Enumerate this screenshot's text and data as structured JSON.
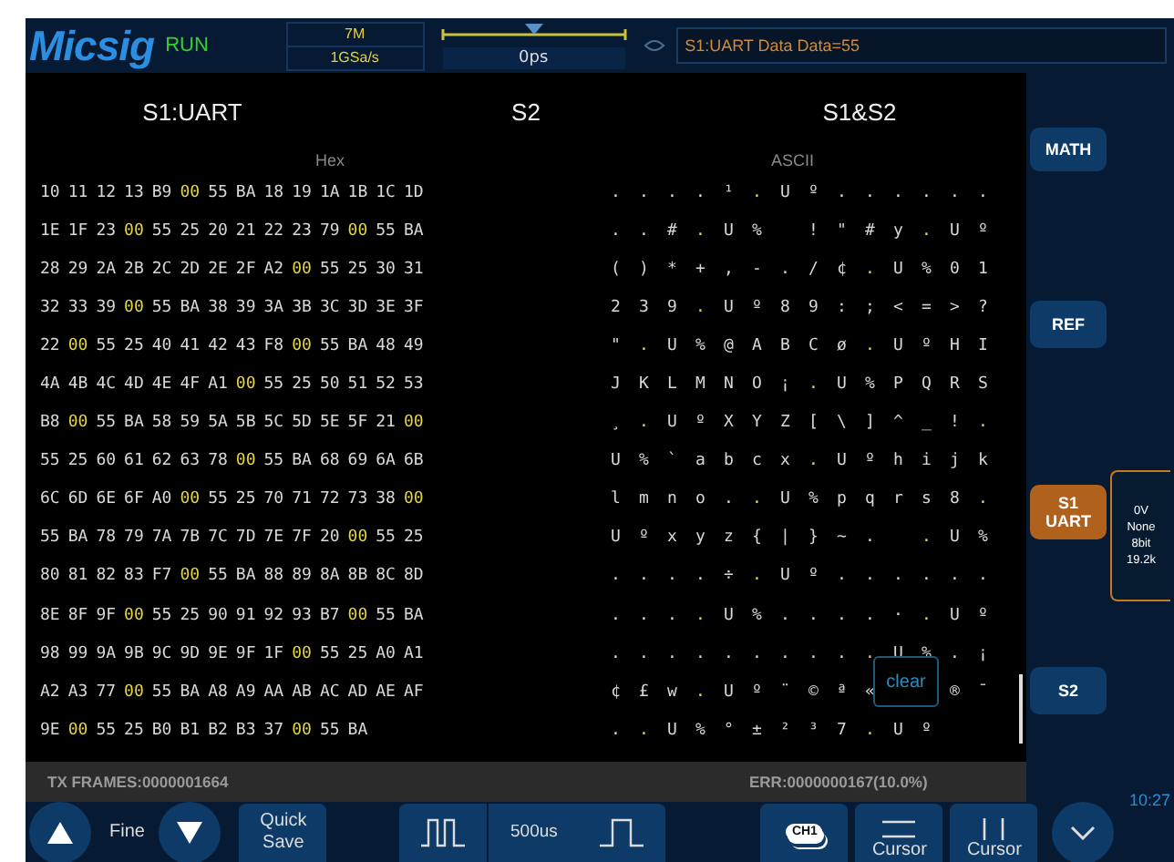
{
  "header": {
    "logo": "Micsig",
    "run_state": "RUN",
    "memory_depth": "7M",
    "sample_rate": "1GSa/s",
    "trigger_position": "0ps",
    "message": "S1:UART Data Data=55"
  },
  "decode": {
    "titles": [
      "S1:UART",
      "S2",
      "S1&S2"
    ],
    "hex_heading": "Hex",
    "ascii_heading": "ASCII",
    "rows": [
      {
        "hex": [
          "10",
          "11",
          "12",
          "13",
          "B9",
          "00",
          "55",
          "BA",
          "18",
          "19",
          "1A",
          "1B",
          "1C",
          "1D"
        ],
        "ascii": "....¹.Uº......",
        "highlight": [
          false,
          false,
          false,
          false,
          false,
          true,
          false,
          false,
          false,
          false,
          false,
          false,
          false,
          false
        ]
      },
      {
        "hex": [
          "1E",
          "1F",
          "23",
          "00",
          "55",
          "25",
          "20",
          "21",
          "22",
          "23",
          "79",
          "00",
          "55",
          "BA"
        ],
        "ascii": "..#.U% !\"#y.Uº",
        "highlight": [
          false,
          false,
          false,
          true,
          false,
          false,
          false,
          false,
          false,
          false,
          false,
          true,
          false,
          false
        ]
      },
      {
        "hex": [
          "28",
          "29",
          "2A",
          "2B",
          "2C",
          "2D",
          "2E",
          "2F",
          "A2",
          "00",
          "55",
          "25",
          "30",
          "31"
        ],
        "ascii": "()*+,-./¢.U%01",
        "highlight": [
          false,
          false,
          false,
          false,
          false,
          false,
          false,
          false,
          false,
          true,
          false,
          false,
          false,
          false
        ]
      },
      {
        "hex": [
          "32",
          "33",
          "39",
          "00",
          "55",
          "BA",
          "38",
          "39",
          "3A",
          "3B",
          "3C",
          "3D",
          "3E",
          "3F"
        ],
        "ascii": "239.Uº89:;<=>?",
        "highlight": [
          false,
          false,
          false,
          true,
          false,
          false,
          false,
          false,
          false,
          false,
          false,
          false,
          false,
          false
        ]
      },
      {
        "hex": [
          "22",
          "00",
          "55",
          "25",
          "40",
          "41",
          "42",
          "43",
          "F8",
          "00",
          "55",
          "BA",
          "48",
          "49"
        ],
        "ascii": "\".U%@ABCø.UºHI",
        "highlight": [
          false,
          true,
          false,
          false,
          false,
          false,
          false,
          false,
          false,
          true,
          false,
          false,
          false,
          false
        ]
      },
      {
        "hex": [
          "4A",
          "4B",
          "4C",
          "4D",
          "4E",
          "4F",
          "A1",
          "00",
          "55",
          "25",
          "50",
          "51",
          "52",
          "53"
        ],
        "ascii": "JKLMNO¡.U%PQRS",
        "highlight": [
          false,
          false,
          false,
          false,
          false,
          false,
          false,
          true,
          false,
          false,
          false,
          false,
          false,
          false
        ]
      },
      {
        "hex": [
          "B8",
          "00",
          "55",
          "BA",
          "58",
          "59",
          "5A",
          "5B",
          "5C",
          "5D",
          "5E",
          "5F",
          "21",
          "00"
        ],
        "ascii": "¸.UºXYZ[\\]^_!.",
        "highlight": [
          false,
          true,
          false,
          false,
          false,
          false,
          false,
          false,
          false,
          false,
          false,
          false,
          false,
          true
        ]
      },
      {
        "hex": [
          "55",
          "25",
          "60",
          "61",
          "62",
          "63",
          "78",
          "00",
          "55",
          "BA",
          "68",
          "69",
          "6A",
          "6B"
        ],
        "ascii": "U%`abcx.Uºhijk",
        "highlight": [
          false,
          false,
          false,
          false,
          false,
          false,
          false,
          true,
          false,
          false,
          false,
          false,
          false,
          false
        ]
      },
      {
        "hex": [
          "6C",
          "6D",
          "6E",
          "6F",
          "A0",
          "00",
          "55",
          "25",
          "70",
          "71",
          "72",
          "73",
          "38",
          "00"
        ],
        "ascii": "lmno..U%pqrs8.",
        "highlight": [
          false,
          false,
          false,
          false,
          false,
          true,
          false,
          false,
          false,
          false,
          false,
          false,
          false,
          true
        ]
      },
      {
        "hex": [
          "55",
          "BA",
          "78",
          "79",
          "7A",
          "7B",
          "7C",
          "7D",
          "7E",
          "7F",
          "20",
          "00",
          "55",
          "25"
        ],
        "ascii": "Uºxyz{|}~. .U%",
        "highlight": [
          false,
          false,
          false,
          false,
          false,
          false,
          false,
          false,
          false,
          false,
          false,
          true,
          false,
          false
        ]
      },
      {
        "hex": [
          "80",
          "81",
          "82",
          "83",
          "F7",
          "00",
          "55",
          "BA",
          "88",
          "89",
          "8A",
          "8B",
          "8C",
          "8D"
        ],
        "ascii": "....÷.Uº......",
        "highlight": [
          false,
          false,
          false,
          false,
          false,
          true,
          false,
          false,
          false,
          false,
          false,
          false,
          false,
          false
        ]
      },
      {
        "hex": [
          "8E",
          "8F",
          "9F",
          "00",
          "55",
          "25",
          "90",
          "91",
          "92",
          "93",
          "B7",
          "00",
          "55",
          "BA"
        ],
        "ascii": "....U%....·.Uº",
        "highlight": [
          false,
          false,
          false,
          true,
          false,
          false,
          false,
          false,
          false,
          false,
          false,
          true,
          false,
          false
        ]
      },
      {
        "hex": [
          "98",
          "99",
          "9A",
          "9B",
          "9C",
          "9D",
          "9E",
          "9F",
          "1F",
          "00",
          "55",
          "25",
          "A0",
          "A1"
        ],
        "ascii": "..........U%.¡",
        "highlight": [
          false,
          false,
          false,
          false,
          false,
          false,
          false,
          false,
          false,
          true,
          false,
          false,
          false,
          false
        ]
      },
      {
        "hex": [
          "A2",
          "A3",
          "77",
          "00",
          "55",
          "BA",
          "A8",
          "A9",
          "AA",
          "AB",
          "AC",
          "AD",
          "AE",
          "AF"
        ],
        "ascii": "¢£w.Uº¨©ª«  ®¯",
        "highlight": [
          false,
          false,
          false,
          true,
          false,
          false,
          false,
          false,
          false,
          false,
          false,
          false,
          false,
          false
        ]
      },
      {
        "hex": [
          "9E",
          "00",
          "55",
          "25",
          "B0",
          "B1",
          "B2",
          "B3",
          "37",
          "00",
          "55",
          "BA"
        ],
        "ascii": "..U%°±²³7.Uº",
        "highlight": [
          false,
          true,
          false,
          false,
          false,
          false,
          false,
          false,
          false,
          true,
          false,
          false
        ]
      }
    ],
    "clear_button": "clear",
    "tx_frames": "TX FRAMES:0000001664",
    "errors": "ERR:0000000167(10.0%)"
  },
  "sidebar": {
    "buttons": [
      {
        "label": "MATH",
        "selected": false
      },
      {
        "label": "REF",
        "selected": false
      },
      {
        "label": "S1 UART",
        "selected": true
      },
      {
        "label": "S2",
        "selected": false
      }
    ],
    "bus_info": [
      "0V",
      "None",
      "8bit",
      "19.2k"
    ]
  },
  "bottom_bar": {
    "fine_label": "Fine",
    "quick_save": "Quick Save",
    "timebase": "500us",
    "channel": "CH1",
    "cursors": [
      "Cursor",
      "Cursor"
    ],
    "time": "10:27"
  }
}
